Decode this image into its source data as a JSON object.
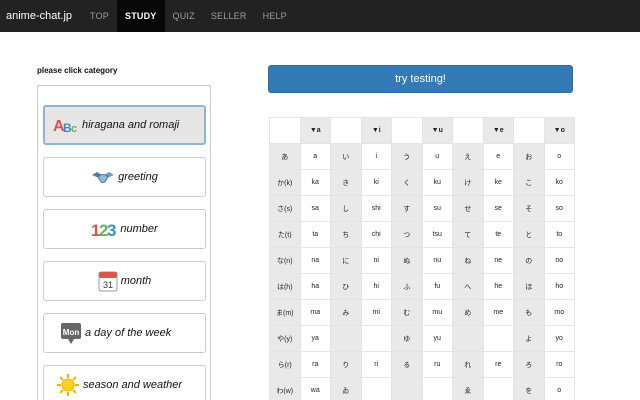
{
  "navbar": {
    "brand": "anime-chat.jp",
    "items": [
      {
        "label": "TOP",
        "active": false
      },
      {
        "label": "STUDY",
        "active": true
      },
      {
        "label": "QUIZ",
        "active": false
      },
      {
        "label": "SELLER",
        "active": false
      },
      {
        "label": "HELP",
        "active": false
      }
    ]
  },
  "category": {
    "title": "please click category",
    "items": [
      {
        "label": "hiragana and romaji",
        "icon": "abc-icon",
        "icon_text": "ABC",
        "selected": true
      },
      {
        "label": "greeting",
        "icon": "handshake-icon",
        "icon_text": "",
        "selected": false
      },
      {
        "label": "number",
        "icon": "number-123-icon",
        "icon_text": "123",
        "selected": false
      },
      {
        "label": "month",
        "icon": "calendar-icon",
        "icon_text": "31",
        "selected": false
      },
      {
        "label": "a day of the week",
        "icon": "mon-icon",
        "icon_text": "Mon",
        "selected": false
      },
      {
        "label": "season and weather",
        "icon": "sun-icon",
        "icon_text": "",
        "selected": false
      }
    ]
  },
  "try_button": {
    "label": "try testing!"
  },
  "kana_table": {
    "header": [
      "",
      "▼a",
      "",
      "▼i",
      "",
      "▼u",
      "",
      "▼e",
      "",
      "▼o"
    ],
    "rows": [
      [
        "あ",
        "a",
        "い",
        "i",
        "う",
        "u",
        "え",
        "e",
        "お",
        "o"
      ],
      [
        "か(k)",
        "ka",
        "き",
        "ki",
        "く",
        "ku",
        "け",
        "ke",
        "こ",
        "ko"
      ],
      [
        "さ(s)",
        "sa",
        "し",
        "shi",
        "す",
        "su",
        "せ",
        "se",
        "そ",
        "so"
      ],
      [
        "た(t)",
        "ta",
        "ち",
        "chi",
        "つ",
        "tsu",
        "て",
        "te",
        "と",
        "to"
      ],
      [
        "な(n)",
        "na",
        "に",
        "ni",
        "ぬ",
        "nu",
        "ね",
        "ne",
        "の",
        "no"
      ],
      [
        "は(h)",
        "ha",
        "ひ",
        "hi",
        "ふ",
        "fu",
        "へ",
        "he",
        "ほ",
        "ho"
      ],
      [
        "ま(m)",
        "ma",
        "み",
        "mi",
        "む",
        "mu",
        "め",
        "me",
        "も",
        "mo"
      ],
      [
        "や(y)",
        "ya",
        "",
        "",
        "ゆ",
        "yu",
        "",
        "",
        "よ",
        "yo"
      ],
      [
        "ら(r)",
        "ra",
        "り",
        "ri",
        "る",
        "ru",
        "れ",
        "re",
        "ろ",
        "ro"
      ],
      [
        "わ(w)",
        "wa",
        "ゐ",
        "",
        "",
        "",
        "ゑ",
        "",
        "を",
        "o"
      ]
    ]
  }
}
